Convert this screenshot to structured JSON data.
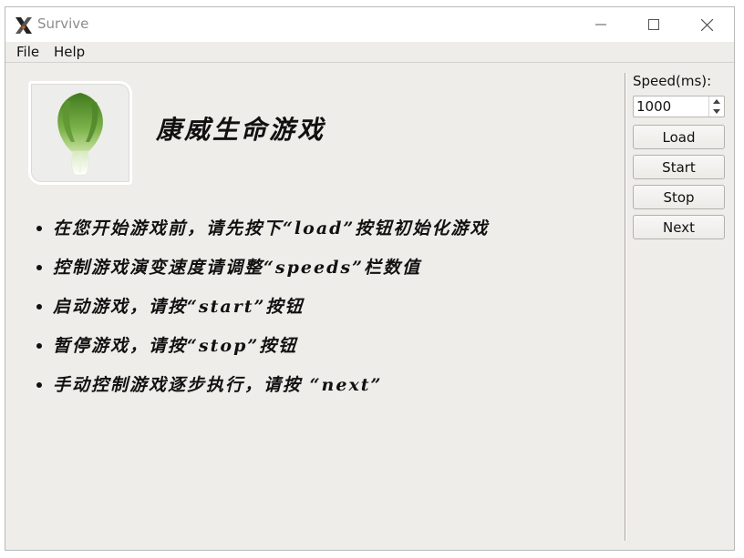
{
  "window": {
    "title": "Survive"
  },
  "menu": {
    "items": [
      "File",
      "Help"
    ]
  },
  "main": {
    "heading": "康威生命游戏",
    "instructions": [
      "在您开始游戏前，请先按下“load”按钮初始化游戏",
      "控制游戏演变速度请调整“speeds”栏数值",
      "启动游戏，请按“start”按钮",
      "暂停游戏，请按“stop”按钮",
      "手动控制游戏逐步执行，请按 “next”"
    ]
  },
  "sidebar": {
    "speed_label": "Speed(ms):",
    "speed_value": "1000",
    "buttons": {
      "load": "Load",
      "start": "Start",
      "stop": "Stop",
      "next": "Next"
    }
  },
  "icons": {
    "app": "x-logo-icon",
    "logo": "bok-choy-icon",
    "minimize": "minimize-icon",
    "maximize": "maximize-icon",
    "close": "close-icon"
  }
}
